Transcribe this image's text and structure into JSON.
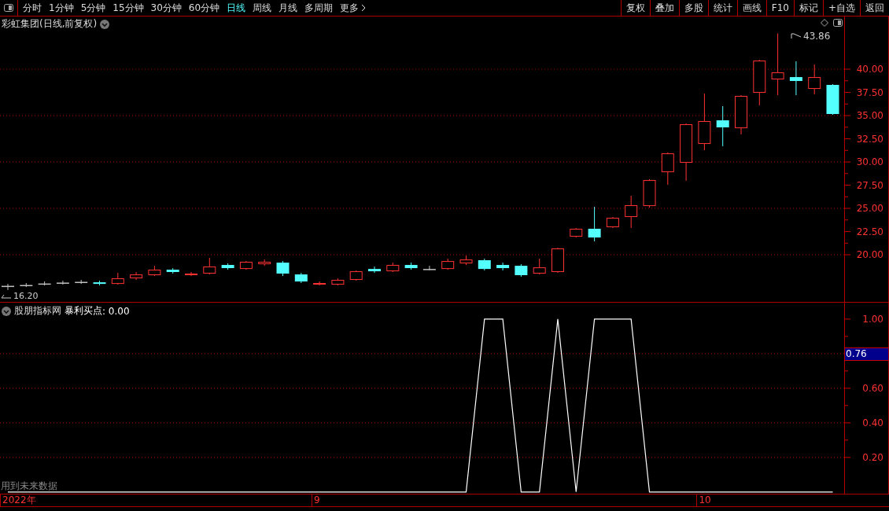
{
  "toolbar": {
    "periods": [
      {
        "label": "分时",
        "selected": false
      },
      {
        "label": "1分钟",
        "selected": false
      },
      {
        "label": "5分钟",
        "selected": false
      },
      {
        "label": "15分钟",
        "selected": false
      },
      {
        "label": "30分钟",
        "selected": false
      },
      {
        "label": "60分钟",
        "selected": false
      },
      {
        "label": "日线",
        "selected": true
      },
      {
        "label": "周线",
        "selected": false
      },
      {
        "label": "月线",
        "selected": false
      },
      {
        "label": "多周期",
        "selected": false
      },
      {
        "label": "更多",
        "selected": false
      }
    ],
    "buttons": [
      "复权",
      "叠加",
      "多股",
      "统计",
      "画线",
      "F10",
      "标记",
      "+自选",
      "返回"
    ]
  },
  "main_chart": {
    "title": "彩虹集团(日线,前复权)",
    "high_marker": "43.86",
    "low_marker": "16.20",
    "chart_data": {
      "type": "candlestick",
      "ylim": [
        14.92,
        45.68
      ],
      "yticks": [
        {
          "value": 40,
          "label": "40.00"
        },
        {
          "value": 37.5,
          "label": "37.50"
        },
        {
          "value": 35,
          "label": "35.00"
        },
        {
          "value": 32.5,
          "label": "32.50"
        },
        {
          "value": 30,
          "label": "30.00"
        },
        {
          "value": 27.5,
          "label": "27.50"
        },
        {
          "value": 25,
          "label": "25.00"
        },
        {
          "value": 22.5,
          "label": "22.50"
        },
        {
          "value": 20,
          "label": "20.00"
        }
      ],
      "grid": true,
      "ohlc": [
        [
          16.65,
          16.86,
          16.2,
          16.65
        ],
        [
          16.74,
          16.95,
          16.53,
          16.74
        ],
        [
          16.9,
          17.12,
          16.69,
          16.9
        ],
        [
          17.0,
          17.2,
          16.78,
          17.0
        ],
        [
          17.08,
          17.29,
          16.86,
          17.08
        ],
        [
          17.03,
          17.2,
          16.69,
          16.86
        ],
        [
          16.86,
          18.05,
          16.78,
          17.46
        ],
        [
          17.46,
          18.14,
          17.29,
          17.88
        ],
        [
          17.8,
          18.81,
          17.71,
          18.39
        ],
        [
          18.39,
          18.56,
          17.97,
          18.14
        ],
        [
          17.8,
          18.14,
          17.71,
          17.97
        ],
        [
          17.97,
          19.66,
          17.88,
          18.73
        ],
        [
          18.9,
          19.07,
          18.39,
          18.56
        ],
        [
          18.47,
          19.32,
          18.39,
          19.24
        ],
        [
          18.98,
          19.49,
          18.81,
          19.24
        ],
        [
          19.15,
          19.32,
          17.71,
          17.97
        ],
        [
          17.88,
          18.05,
          16.95,
          17.12
        ],
        [
          16.78,
          17.12,
          16.69,
          16.95
        ],
        [
          16.78,
          17.46,
          16.69,
          17.29
        ],
        [
          17.29,
          18.31,
          17.2,
          18.22
        ],
        [
          18.47,
          18.73,
          18.05,
          18.22
        ],
        [
          18.22,
          19.15,
          18.14,
          18.9
        ],
        [
          18.9,
          19.15,
          18.39,
          18.56
        ],
        [
          18.47,
          18.81,
          18.31,
          18.47
        ],
        [
          18.47,
          19.58,
          18.39,
          19.32
        ],
        [
          19.07,
          19.91,
          18.9,
          19.49
        ],
        [
          19.41,
          19.58,
          18.31,
          18.47
        ],
        [
          18.9,
          19.15,
          18.31,
          18.56
        ],
        [
          18.81,
          18.98,
          17.63,
          17.8
        ],
        [
          17.97,
          19.58,
          17.88,
          18.64
        ],
        [
          18.14,
          20.76,
          18.05,
          20.68
        ],
        [
          21.95,
          22.88,
          21.86,
          22.8
        ],
        [
          22.8,
          25.17,
          21.44,
          21.86
        ],
        [
          22.97,
          24.07,
          22.88,
          23.98
        ],
        [
          24.07,
          26.36,
          22.88,
          25.34
        ],
        [
          25.25,
          28.14,
          25.08,
          28.05
        ],
        [
          28.9,
          31.02,
          27.54,
          30.93
        ],
        [
          29.92,
          34.15,
          27.97,
          34.07
        ],
        [
          31.95,
          37.37,
          31.27,
          34.41
        ],
        [
          34.49,
          36.02,
          31.69,
          33.73
        ],
        [
          33.64,
          37.2,
          32.97,
          37.12
        ],
        [
          37.46,
          41.02,
          36.1,
          40.93
        ],
        [
          38.9,
          43.86,
          37.2,
          39.66
        ],
        [
          39.15,
          40.85,
          37.2,
          38.73
        ],
        [
          37.88,
          40.51,
          37.29,
          39.15
        ],
        [
          38.31,
          38.39,
          35.08,
          35.17
        ]
      ]
    }
  },
  "indicator": {
    "source": "股朋指标网",
    "value": ": 0.00",
    "cursor_value": "0.76",
    "note": "用到未来数据",
    "chart_data": {
      "type": "line",
      "grid": true,
      "ylim": [
        -0.01,
        1.095
      ],
      "yticks": [
        {
          "value": 1,
          "label": "1.00"
        },
        {
          "value": 0.6,
          "label": "0.60"
        },
        {
          "value": 0.4,
          "label": "0.40"
        },
        {
          "value": 0.2,
          "label": "0.20"
        }
      ],
      "series": [
        {
          "name": "暴利买点",
          "color": "#ffffff",
          "values": [
            0,
            0,
            0,
            0,
            0,
            0,
            0,
            0,
            0,
            0,
            0,
            0,
            0,
            0,
            0,
            0,
            0,
            0,
            0,
            0,
            0,
            0,
            0,
            0,
            0,
            0,
            1,
            1,
            0,
            0,
            1,
            0,
            1,
            1,
            1,
            0,
            0,
            0,
            0,
            0,
            0,
            0,
            0,
            0,
            0,
            0
          ]
        }
      ]
    }
  },
  "date_axis": [
    "2022年",
    "9",
    "10"
  ]
}
